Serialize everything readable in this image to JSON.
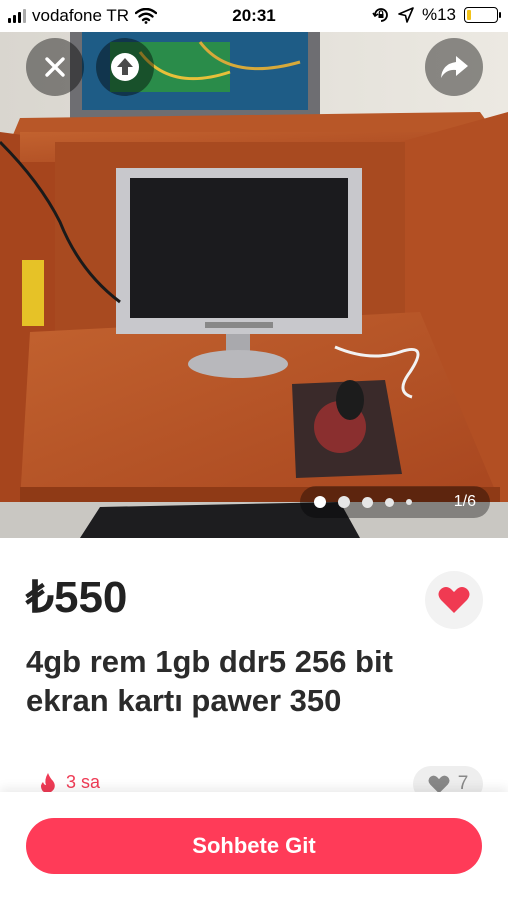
{
  "status_bar": {
    "carrier": "vodafone TR",
    "time": "20:31",
    "battery": "%13",
    "battery_level": 0.13,
    "icons": [
      "signal-icon",
      "wifi-icon",
      "orientation-lock-icon",
      "location-icon",
      "battery-icon"
    ]
  },
  "gallery": {
    "counter": "1/6",
    "current_index": 1,
    "total": 6,
    "buttons": [
      "close-icon",
      "upload-icon",
      "share-icon"
    ]
  },
  "listing": {
    "price": "₺550",
    "title": "4gb rem 1gb ddr5 256 bit ekran kartı pawer 350",
    "posted_ago": "3 sa",
    "likes": "7"
  },
  "actions": {
    "chat_label": "Sohbete Git"
  },
  "colors": {
    "accent": "#ff3b58",
    "heart": "#f03a52",
    "battery": "#f2c31a"
  }
}
